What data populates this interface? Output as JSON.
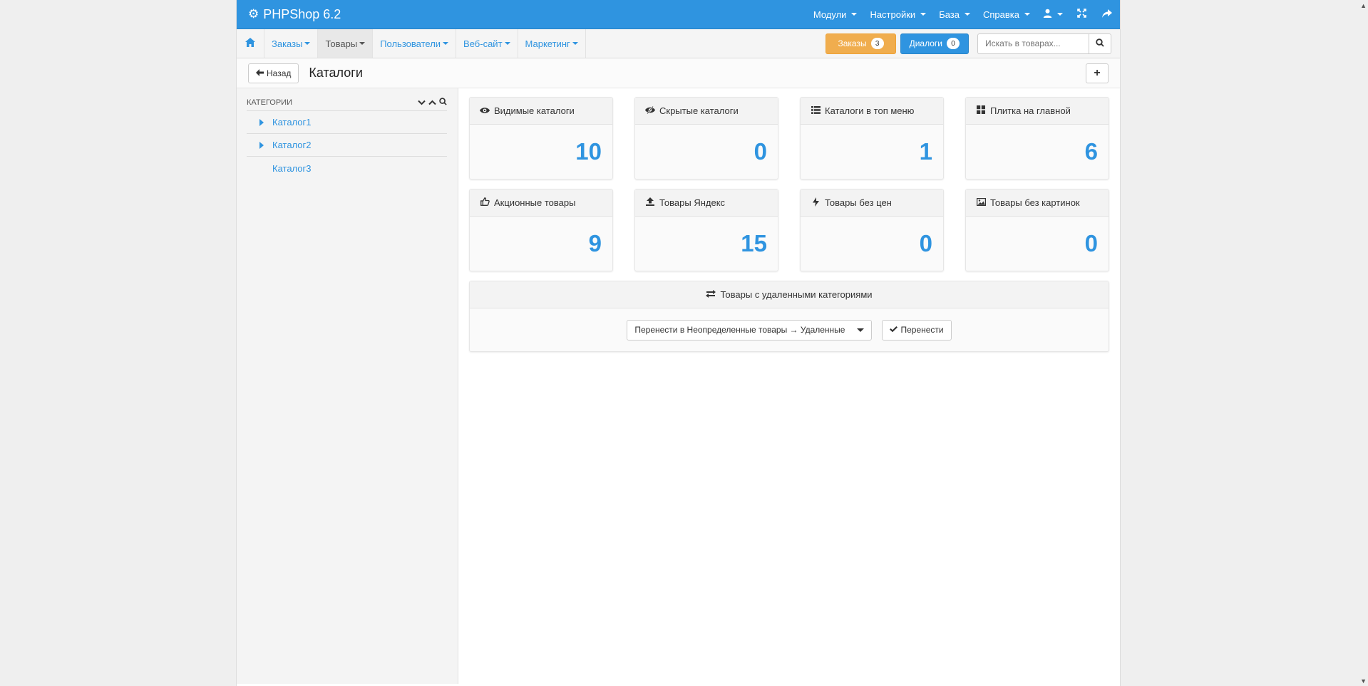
{
  "brand": {
    "name": "PHPShop 6.2"
  },
  "topnav": [
    {
      "label": "Модули"
    },
    {
      "label": "Настройки"
    },
    {
      "label": "База"
    },
    {
      "label": "Справка"
    }
  ],
  "subnav": [
    {
      "label": "Заказы"
    },
    {
      "label": "Товары"
    },
    {
      "label": "Пользователи"
    },
    {
      "label": "Веб-сайт"
    },
    {
      "label": "Маркетинг"
    }
  ],
  "orders_button": {
    "label": "Заказы",
    "count": "3"
  },
  "dialogs_button": {
    "label": "Диалоги",
    "count": "0"
  },
  "search": {
    "placeholder": "Искать в товарах..."
  },
  "titlebar": {
    "back_label": "Назад",
    "title": "Каталоги"
  },
  "sidebar": {
    "heading": "КАТЕГОРИИ",
    "items": [
      {
        "label": "Каталог1"
      },
      {
        "label": "Каталог2"
      },
      {
        "label": "Каталог3"
      }
    ]
  },
  "cards": [
    {
      "title": "Видимые каталоги",
      "value": "10",
      "icon": "eye-icon"
    },
    {
      "title": "Скрытые каталоги",
      "value": "0",
      "icon": "eye-slash-icon"
    },
    {
      "title": "Каталоги в топ меню",
      "value": "1",
      "icon": "list-icon"
    },
    {
      "title": "Плитка на главной",
      "value": "6",
      "icon": "grid-icon"
    },
    {
      "title": "Акционные товары",
      "value": "9",
      "icon": "thumbs-up-icon"
    },
    {
      "title": "Товары Яндекс",
      "value": "15",
      "icon": "upload-icon"
    },
    {
      "title": "Товары без цен",
      "value": "0",
      "icon": "bolt-icon"
    },
    {
      "title": "Товары без картинок",
      "value": "0",
      "icon": "picture-icon"
    }
  ],
  "deleted_panel": {
    "title": "Товары с удаленными категориями",
    "select_value": "Перенести в Неопределенные товары → Удаленные",
    "move_label": "Перенести"
  },
  "colors": {
    "primary": "#2f94e0",
    "warning": "#f0ad4e"
  }
}
